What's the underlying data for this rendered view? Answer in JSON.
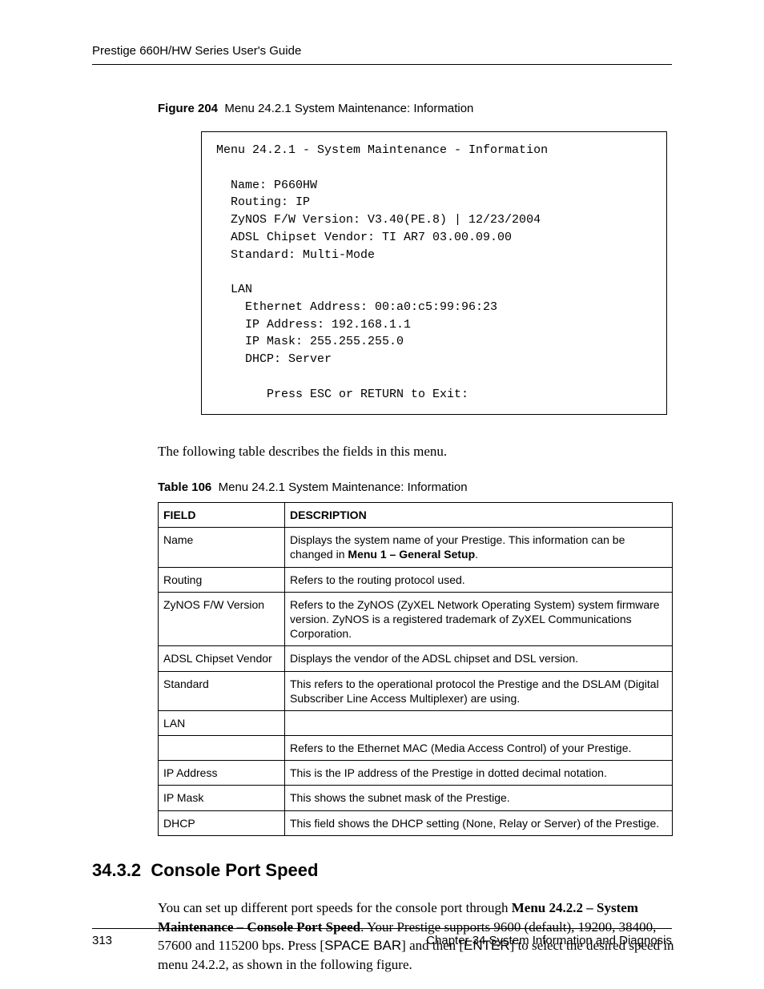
{
  "header": {
    "title": "Prestige 660H/HW Series User's Guide"
  },
  "figure": {
    "label": "Figure 204",
    "caption": "Menu 24.2.1 System Maintenance: Information",
    "terminal": "Menu 24.2.1 - System Maintenance - Information\n\n  Name: P660HW\n  Routing: IP\n  ZyNOS F/W Version: V3.40(PE.8) | 12/23/2004\n  ADSL Chipset Vendor: TI AR7 03.00.09.00\n  Standard: Multi-Mode\n\n  LAN\n    Ethernet Address: 00:a0:c5:99:96:23\n    IP Address: 192.168.1.1\n    IP Mask: 255.255.255.0\n    DHCP: Server\n\n       Press ESC or RETURN to Exit:"
  },
  "intro_text": "The following table describes the fields in this menu.",
  "table": {
    "label": "Table 106",
    "caption": "Menu 24.2.1 System Maintenance: Information",
    "head_field": "FIELD",
    "head_desc": "DESCRIPTION",
    "rows": [
      {
        "field": "Name",
        "desc_pre": "Displays the system name of your Prestige. This information can be changed in ",
        "desc_bold": "Menu 1 – General Setup",
        "desc_post": "."
      },
      {
        "field": "Routing",
        "desc": "Refers to the routing protocol used."
      },
      {
        "field": "ZyNOS F/W Version",
        "desc": "Refers to the ZyNOS (ZyXEL Network Operating System) system firmware version. ZyNOS is a registered trademark of ZyXEL Communications Corporation."
      },
      {
        "field": "ADSL Chipset Vendor",
        "desc": "Displays the vendor of the ADSL chipset and DSL version."
      },
      {
        "field": "Standard",
        "desc": "This refers to the operational protocol the Prestige and the DSLAM (Digital Subscriber Line Access Multiplexer) are using."
      },
      {
        "field": "LAN",
        "desc": ""
      },
      {
        "field": "",
        "desc": "Refers to the Ethernet MAC (Media Access Control) of your Prestige."
      },
      {
        "field": "IP Address",
        "desc": "This is the IP address of the Prestige in dotted decimal notation."
      },
      {
        "field": "IP Mask",
        "desc": "This shows the subnet mask of the Prestige."
      },
      {
        "field": "DHCP",
        "desc": "This field shows the DHCP setting (None, Relay or Server) of the Prestige."
      }
    ]
  },
  "section": {
    "number": "34.3.2",
    "title": "Console Port Speed",
    "para_parts": {
      "t1": "You can set up different port speeds for the console port through ",
      "b1": "Menu 24.2.2 – System Maintenance – Console Port Speed",
      "t2": ". Your Prestige supports 9600 (default), 19200, 38400, 57600 and 115200 bps. Press [",
      "k1": "SPACE BAR",
      "t3": "] and then [",
      "k2": "ENTER",
      "t4": "] to select the desired speed in menu 24.2.2, as shown in the following figure."
    }
  },
  "footer": {
    "page": "313",
    "chapter": "Chapter 34 System Information and Diagnosis"
  }
}
